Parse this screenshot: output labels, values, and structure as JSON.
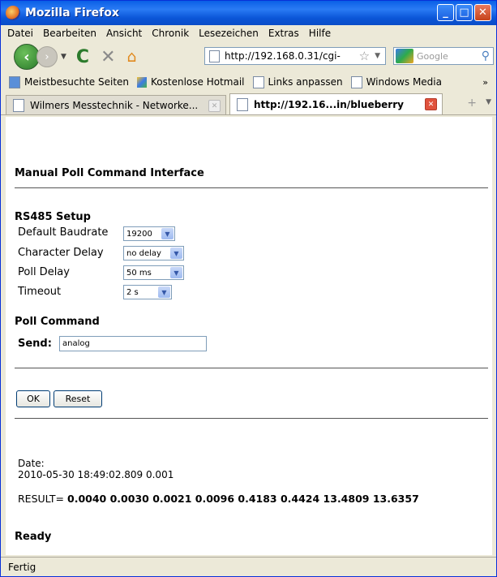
{
  "window": {
    "title": "Mozilla Firefox"
  },
  "menu": [
    "Datei",
    "Bearbeiten",
    "Ansicht",
    "Chronik",
    "Lesezeichen",
    "Extras",
    "Hilfe"
  ],
  "nav": {
    "url": "http://192.168.0.31/cgi-",
    "search_placeholder": "Google"
  },
  "bookmarks": [
    "Meistbesuchte Seiten",
    "Kostenlose Hotmail",
    "Links anpassen",
    "Windows Media"
  ],
  "tabs": [
    {
      "label": "Wilmers Messtechnik - Networke...",
      "active": false
    },
    {
      "label": "http://192.16...in/blueberry",
      "active": true
    }
  ],
  "page": {
    "title": "Manual Poll Command Interface",
    "rs485_heading": "RS485 Setup",
    "fields": [
      {
        "label": "Default Baudrate",
        "value": "19200"
      },
      {
        "label": "Character Delay",
        "value": "no delay"
      },
      {
        "label": "Poll Delay",
        "value": "50 ms"
      },
      {
        "label": "Timeout",
        "value": "2 s"
      }
    ],
    "poll_heading": "Poll Command",
    "send_label": "Send:",
    "send_value": "analog",
    "ok_label": "OK",
    "reset_label": "Reset",
    "date_label": "Date:",
    "date_value": "2010-05-30 18:49:02.809 0.001",
    "result_label": "RESULT=",
    "result_value": "0.0040 0.0030 0.0021 0.0096 0.4183 0.4424 13.4809 13.6357",
    "ready": "Ready"
  },
  "status": {
    "text": "Fertig"
  }
}
